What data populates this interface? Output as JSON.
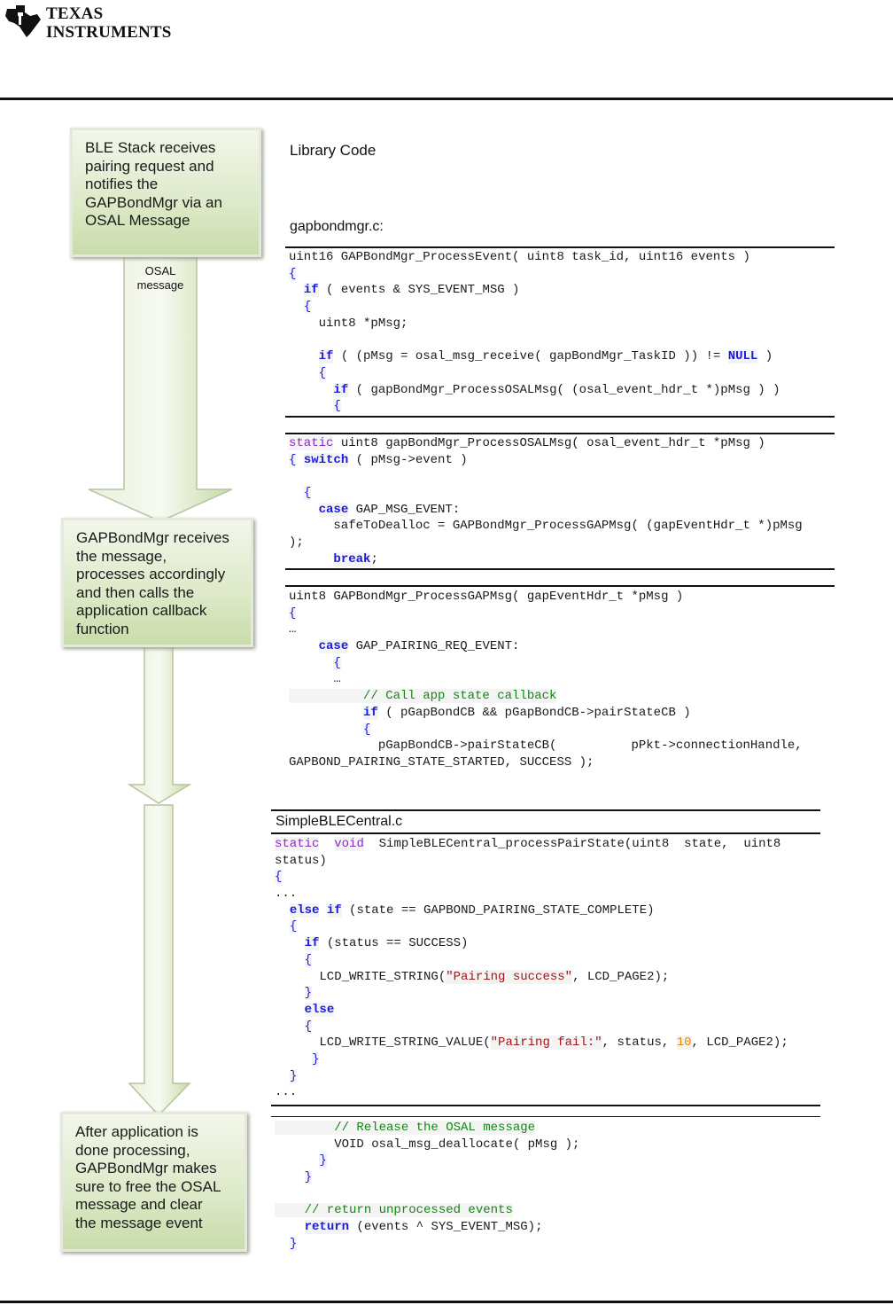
{
  "header": {
    "logo_line1": "TEXAS",
    "logo_line2": "INSTRUMENTS",
    "logo_icon": "ti-texas-logo-icon"
  },
  "flow": {
    "step1": "BLE Stack receives\npairing request and\nnotifies the\nGAPBondMgr via an\nOSAL Message",
    "arrow1_label": "OSAL\nmessage",
    "step2": "GAPBondMgr receives\nthe message,\nprocesses accordingly\nand then calls the\napplication callback\nfunction",
    "step3": "After application is\ndone processing,\nGAPBondMgr makes\nsure to free the OSAL\nmessage and clear\nthe message event",
    "colors": {
      "box_top": "#f2f7ea",
      "box_bottom": "#c9dcaa",
      "arrow_fill": "#d6e6bd"
    }
  },
  "library": {
    "title": "Library Code",
    "file1": "gapbondmgr.c:",
    "file2": "SimpleBLECentral.c"
  },
  "code": {
    "colors": {
      "keyword": "#1a1adb",
      "string": "#a31515",
      "comment": "#118811",
      "number": "#e08a00",
      "static": "#8a2bbf"
    },
    "panel1": [
      "uint16 GAPBondMgr_ProcessEvent( uint8 task_id, uint16 events )",
      "{",
      "  if ( events & SYS_EVENT_MSG )",
      "  {",
      "    uint8 *pMsg;",
      "",
      "    if ( (pMsg = osal_msg_receive( gapBondMgr_TaskID )) != NULL )",
      "    {",
      "      if ( gapBondMgr_ProcessOSALMsg( (osal_event_hdr_t *)pMsg ) )",
      "      {"
    ],
    "panel2": [
      "static uint8 gapBondMgr_ProcessOSALMsg( osal_event_hdr_t *pMsg )",
      "{ switch ( pMsg->event )",
      "",
      "  {",
      "    case GAP_MSG_EVENT:",
      "      safeToDealloc = GAPBondMgr_ProcessGAPMsg( (gapEventHdr_t *)pMsg",
      ");",
      "      break;"
    ],
    "panel3": [
      "uint8 GAPBondMgr_ProcessGAPMsg( gapEventHdr_t *pMsg )",
      "{",
      "…",
      "    case GAP_PAIRING_REQ_EVENT:",
      "      {",
      "      …",
      "          // Call app state callback",
      "          if ( pGapBondCB && pGapBondCB->pairStateCB )",
      "          {",
      "            pGapBondCB->pairStateCB(          pPkt->connectionHandle,",
      "GAPBOND_PAIRING_STATE_STARTED, SUCCESS );"
    ],
    "panel4_top": "          }",
    "panel4": [
      "static  void  SimpleBLECentral_processPairState(uint8  state,  uint8",
      "status)",
      "{",
      "...",
      "  else if (state == GAPBOND_PAIRING_STATE_COMPLETE)",
      "  {",
      "    if (status == SUCCESS)",
      "    {",
      "      LCD_WRITE_STRING(\"Pairing success\", LCD_PAGE2);",
      "    }",
      "    else",
      "    {",
      "      LCD_WRITE_STRING_VALUE(\"Pairing fail:\", status, 10, LCD_PAGE2);",
      "     }",
      "  }",
      "..."
    ],
    "panel5": [
      "        // Release the OSAL message",
      "        VOID osal_msg_deallocate( pMsg );",
      "      }",
      "    }",
      "",
      "    // return unprocessed events",
      "    return (events ^ SYS_EVENT_MSG);",
      "  }"
    ]
  }
}
